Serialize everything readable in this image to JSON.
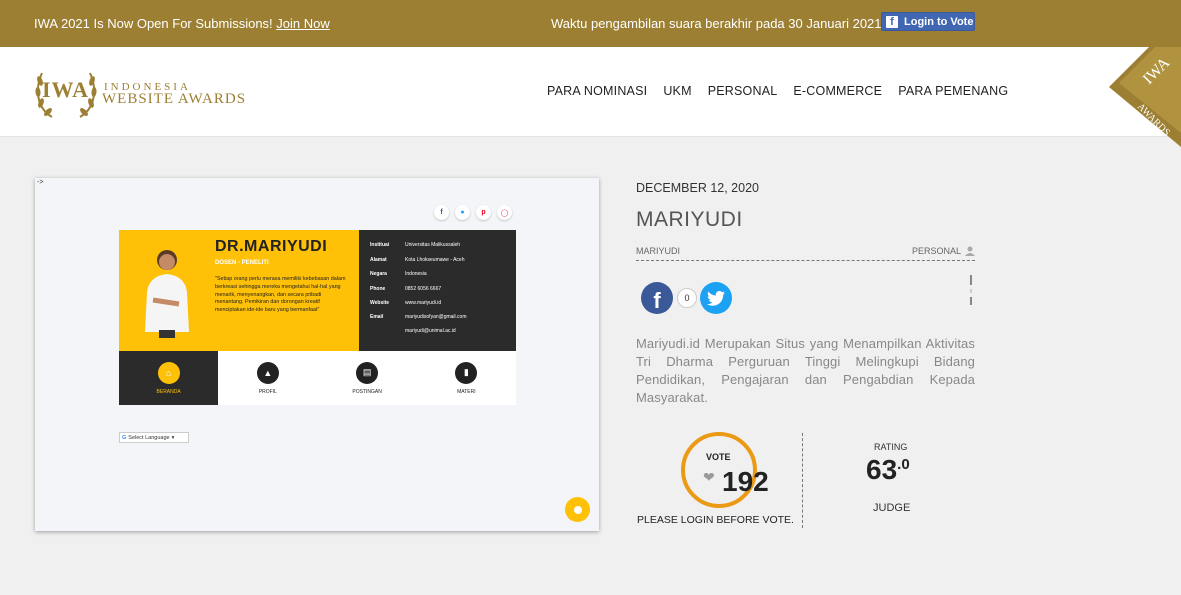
{
  "topbar": {
    "announcement": "IWA 2021 Is Now Open For Submissions!",
    "join_link": "Join Now",
    "deadline": "Waktu pengambilan suara berakhir pada 30 Januari 2021 |",
    "login_button": "Login to Vote"
  },
  "logo": {
    "mark": "IWA",
    "line1": "INDONESIA",
    "line2": "WEBSITE AWARDS"
  },
  "nav": [
    "PARA NOMINASI",
    "UKM",
    "PERSONAL",
    "E-COMMERCE",
    "PARA PEMENANG"
  ],
  "ribbon": {
    "line1": "IWA",
    "line2": "AWARDS"
  },
  "preview": {
    "arrow": "->",
    "name": "DR.MARIYUDI",
    "role": "DOSEN - PENELITI",
    "quote": "\"Setiap orang perlu merasa memiliki kebebasan dalam berkreasi sehingga mereka mengetahui hal-hal yang menarik, menyenangkan, dan secara pribadi menantang. Pemikiran dan dorongan kreatif menciptakan ide-ide baru yang bermanfaat\"",
    "info": [
      {
        "label": "Instituai",
        "value": "Universitas Malikussaleh"
      },
      {
        "label": "Alamat",
        "value": "Kota Lhokseumawe - Aceh"
      },
      {
        "label": "Negara",
        "value": "Indonesia"
      },
      {
        "label": "Phone",
        "value": "0852 6056 6667"
      },
      {
        "label": "Website",
        "value": "www.mariyudi.id"
      },
      {
        "label": "Email",
        "value": "mariyudisofyan@gmail.com"
      },
      {
        "label": "",
        "value": "mariyudi@unimal.ac.id"
      }
    ],
    "menu": [
      "BERANDA",
      "PROFIL",
      "POSTINGAN",
      "MATERI"
    ],
    "select_language": "Select Language"
  },
  "entry": {
    "date": "DECEMBER 12, 2020",
    "title": "MARIYUDI",
    "author": "MARIYUDI",
    "category": "PERSONAL",
    "share_count": "0",
    "description": "Mariyudi.id Merupakan Situs yang Menampilkan Aktivitas Tri Dharma Perguruan Tinggi Melingkupi Bidang Pendidikan, Pengajaran dan Pengabdian Kepada Masyarakat."
  },
  "vote": {
    "label": "VOTE",
    "count": "192",
    "note": "PLEASE LOGIN BEFORE VOTE."
  },
  "rating": {
    "label": "RATING",
    "value": "63",
    "decimal": ".0",
    "judge": "JUDGE"
  },
  "colors": {
    "gold": "#9c7f32",
    "vote_ring": "#eb9a16",
    "facebook": "#3b5998",
    "twitter": "#1da1f2",
    "preview_yellow": "#ffc107"
  }
}
